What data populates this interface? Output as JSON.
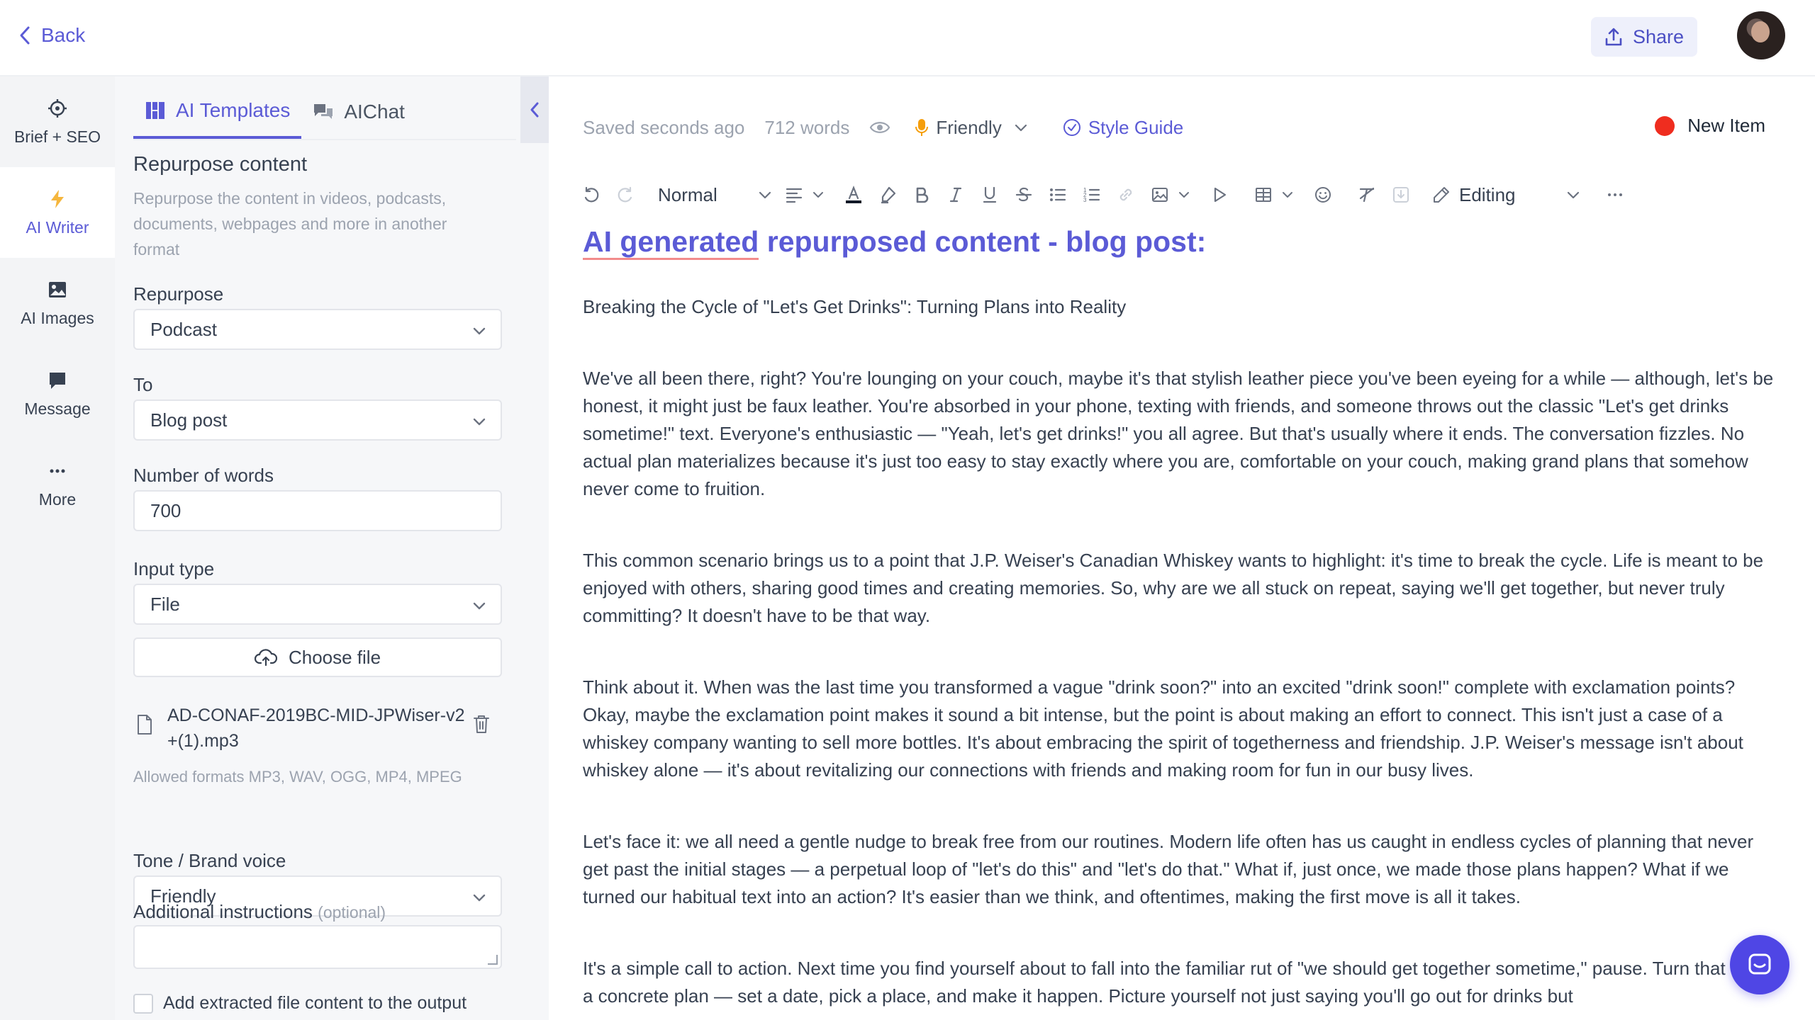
{
  "header": {
    "back_label": "Back",
    "share_label": "Share"
  },
  "rail": {
    "items": [
      {
        "label": "Brief + SEO",
        "icon": "crosshair-icon"
      },
      {
        "label": "AI Writer",
        "icon": "lightning-icon",
        "active": true
      },
      {
        "label": "AI Images",
        "icon": "image-icon"
      },
      {
        "label": "Message",
        "icon": "chat-icon"
      },
      {
        "label": "More",
        "icon": "ellipsis-icon"
      }
    ]
  },
  "panel": {
    "tabs": [
      {
        "label": "AI Templates",
        "icon": "grid-icon",
        "active": true
      },
      {
        "label": "AIChat",
        "icon": "chat-bubbles-icon"
      }
    ],
    "title": "Repurpose content",
    "description": "Repurpose the content in videos, podcasts, documents, webpages and more in another format",
    "fields": {
      "repurpose_label": "Repurpose",
      "repurpose_value": "Podcast",
      "to_label": "To",
      "to_value": "Blog post",
      "words_label": "Number of words",
      "words_value": "700",
      "input_type_label": "Input type",
      "input_type_value": "File",
      "choose_file_label": "Choose file",
      "file_name": "AD-CONAF-2019BC-MID-JPWiser-v2+(1).mp3",
      "allowed_formats": "Allowed formats MP3, WAV, OGG, MP4, MPEG",
      "tone_label": "Tone / Brand voice",
      "tone_value": "Friendly",
      "additional_label": "Additional instructions",
      "additional_optional": "(optional)",
      "checkbox_label": "Add extracted file content to the output"
    }
  },
  "editor": {
    "saved_status": "Saved seconds ago",
    "word_count": "712 words",
    "tone": "Friendly",
    "style_guide": "Style Guide",
    "new_item": "New Item",
    "block_style": "Normal",
    "mode": "Editing",
    "title_part1": "AI generated",
    "title_part2": " repurposed content - blog post:",
    "paragraphs": [
      "Breaking the Cycle of \"Let's Get Drinks\": Turning Plans into Reality",
      "We've all been there, right? You're lounging on your couch, maybe it's that stylish leather piece you've been eyeing for a while — although, let's be honest, it might just be faux leather. You're absorbed in your phone, texting with friends, and someone throws out the classic \"Let's get drinks sometime!\" text. Everyone's enthusiastic — \"Yeah, let's get drinks!\" you all agree. But that's usually where it ends. The conversation fizzles. No actual plan materializes because it's just too easy to stay exactly where you are, comfortable on your couch, making grand plans that somehow never come to fruition.",
      "This common scenario brings us to a point that J.P. Weiser's Canadian Whiskey wants to highlight: it's time to break the cycle. Life is meant to be enjoyed with others, sharing good times and creating memories. So, why are we all stuck on repeat, saying we'll get together, but never truly committing? It doesn't have to be that way.",
      "Think about it. When was the last time you transformed a vague \"drink soon?\" into an excited \"drink soon!\" complete with exclamation points? Okay, maybe the exclamation point makes it sound a bit intense, but the point is about making an effort to connect. This isn't just a case of a whiskey company wanting to sell more bottles. It's about embracing the spirit of togetherness and friendship. J.P. Weiser's message isn't about whiskey alone — it's about revitalizing our connections with friends and making room for fun in our busy lives.",
      "Let's face it: we all need a gentle nudge to break free from our routines. Modern life often has us caught in endless cycles of planning that never get past the initial stages — a perpetual loop of \"let's do this\" and \"let's do that.\" What if, just once, we made those plans happen? What if we turned our habitual text into an action? It's easier than we think, and oftentimes, making the first move is all it takes.",
      "It's a simple call to action. Next time you find yourself about to fall into the familiar rut of \"we should get together sometime,\" pause. Turn that into a concrete plan — set a date, pick a place, and make it happen. Picture yourself not just saying you'll go out for drinks but"
    ]
  },
  "colors": {
    "accent": "#5b5bd6",
    "new_item_dot": "#ef2d1f",
    "chat_bubble": "#4f46e5"
  }
}
